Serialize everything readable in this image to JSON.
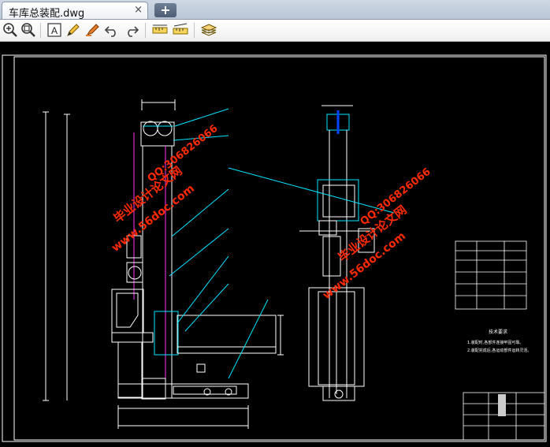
{
  "tab": {
    "title": "车库总装配.dwg",
    "close": "×",
    "new": "+"
  },
  "toolbar": {
    "tools": [
      "zoom-in",
      "zoom-extents",
      "text-tool",
      "pencil",
      "marker",
      "undo",
      "redo",
      "measure-length",
      "measure-area",
      "layers"
    ]
  },
  "drawing": {
    "watermarks": [
      {
        "cn": "毕业设计论文网",
        "url": "www.56doc.com",
        "qq": "QQ:306826066"
      },
      {
        "cn": "毕业设计论文网",
        "url": "www.56doc.com",
        "qq": "QQ:306826066"
      }
    ],
    "notes_title": "技术要求",
    "notes": [
      "1.装配时,各部件连接牢固可靠。",
      "2.装配完成后,各运动部件运转灵活。"
    ]
  },
  "colors": {
    "line_white": "#ffffff",
    "line_cyan": "#00e5ff",
    "line_magenta": "#ff33ff",
    "watermark": "#ff2a00",
    "background": "#000000"
  }
}
